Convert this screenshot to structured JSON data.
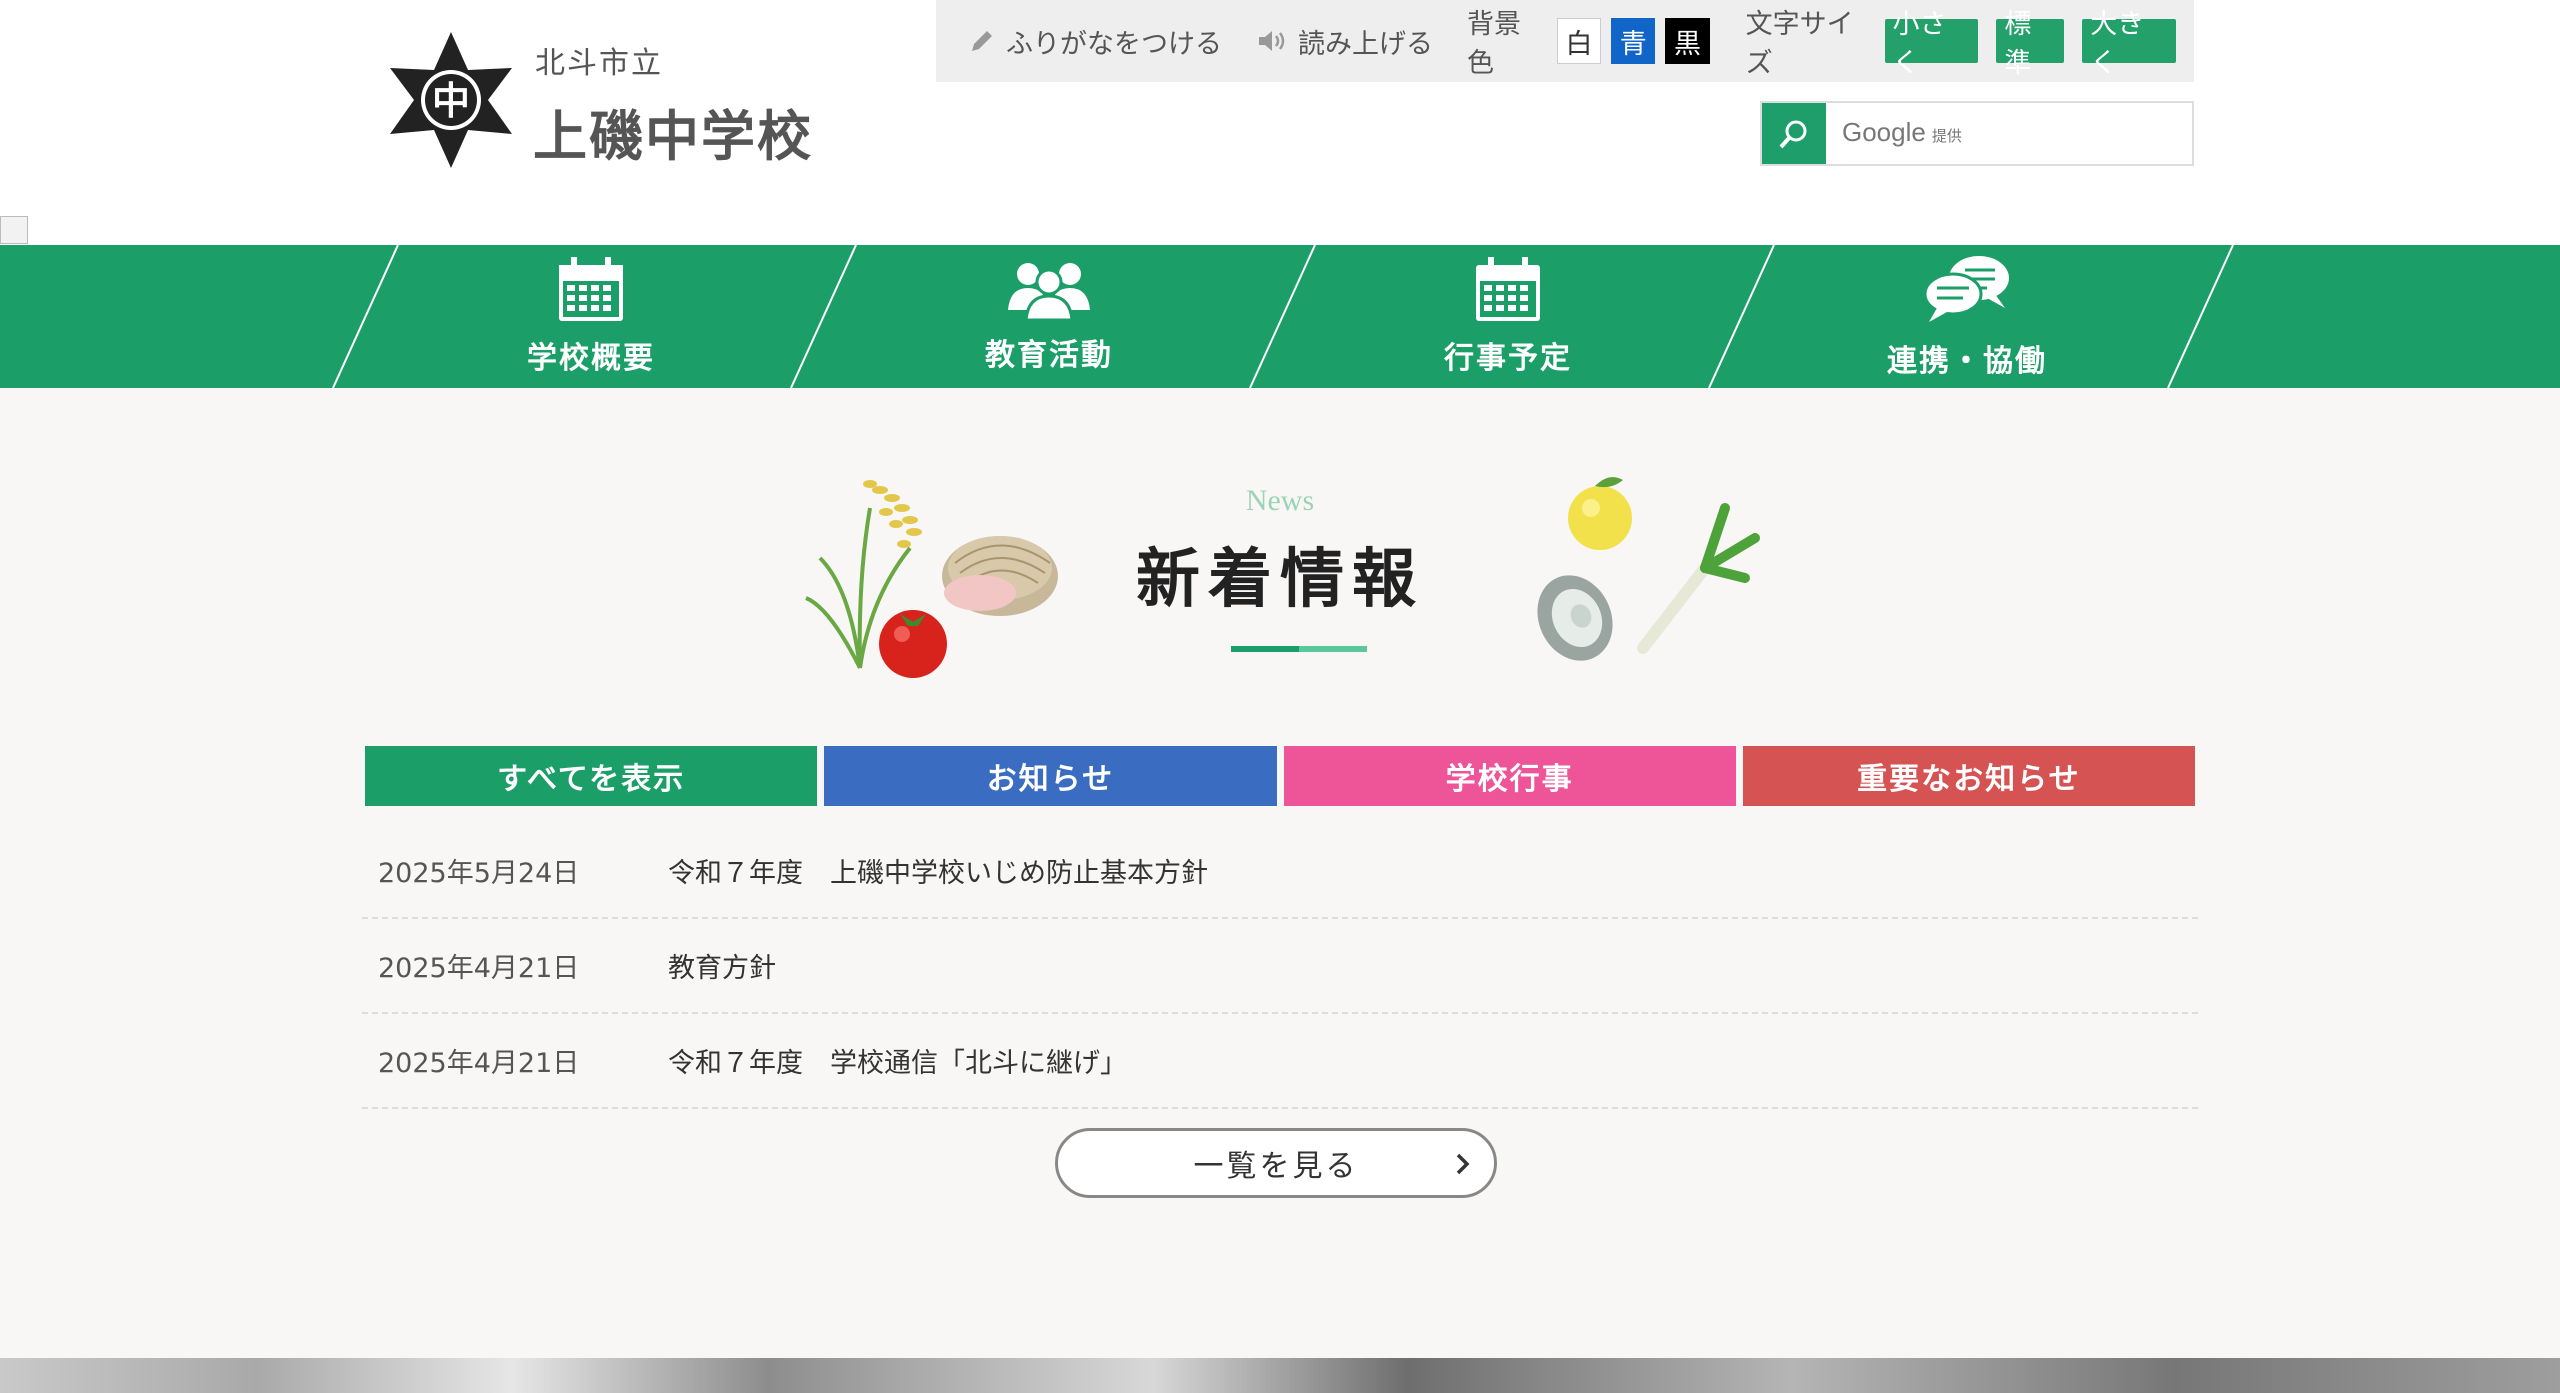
{
  "header": {
    "city": "北斗市立",
    "school_name": "上磯中学校",
    "logo_char": "中"
  },
  "toolbar": {
    "furigana": "ふりがなをつける",
    "read_aloud": "読み上げる",
    "bg_label": "背景色",
    "bg_white": "白",
    "bg_blue": "青",
    "bg_black": "黒",
    "font_size_label": "文字サイズ",
    "font_small": "小さく",
    "font_standard": "標準",
    "font_large": "大きく"
  },
  "search": {
    "brand": "Google",
    "brand_suffix": "提供"
  },
  "nav": {
    "items": [
      {
        "label": "学校概要",
        "icon": "calendar-icon"
      },
      {
        "label": "教育活動",
        "icon": "people-icon"
      },
      {
        "label": "行事予定",
        "icon": "calendar-icon"
      },
      {
        "label": "連携・協働",
        "icon": "chat-bubbles-icon"
      }
    ]
  },
  "news": {
    "heading_en": "News",
    "heading": "新着情報",
    "tabs": [
      {
        "label": "すべてを表示",
        "color": "#1c9e69"
      },
      {
        "label": "お知らせ",
        "color": "#3a6dc1"
      },
      {
        "label": "学校行事",
        "color": "#ee5599"
      },
      {
        "label": "重要なお知らせ",
        "color": "#d65353"
      }
    ],
    "items": [
      {
        "date": "2025年5月24日",
        "title": "令和７年度　上磯中学校いじめ防止基本方針"
      },
      {
        "date": "2025年4月21日",
        "title": "教育方針"
      },
      {
        "date": "2025年4月21日",
        "title": "令和７年度　学校通信「北斗に継げ」"
      }
    ],
    "more_label": "一覧を見る"
  },
  "colors": {
    "brand_green": "#1c9e69",
    "toolbar_bg": "#eeeeee",
    "main_bg": "#f8f7f5"
  }
}
